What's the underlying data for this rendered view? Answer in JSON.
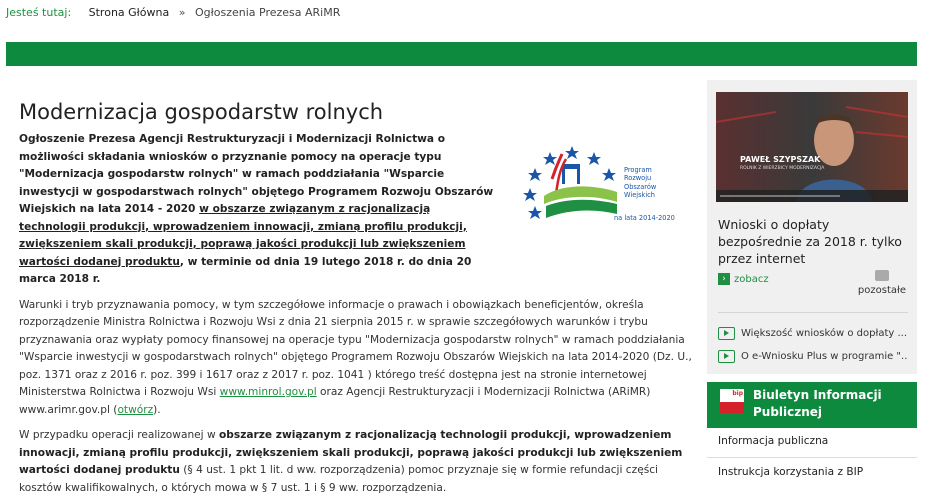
{
  "breadcrumb": {
    "label": "Jesteś tutaj:",
    "home": "Strona Główna",
    "separator": "»",
    "current": "Ogłoszenia Prezesa ARiMR"
  },
  "article": {
    "title": "Modernizacja gospodarstw rolnych",
    "lead_part1": "Ogłoszenie Prezesa Agencji Restrukturyzacji i Modernizacji Rolnictwa o możliwości składania wniosków o przyznanie pomocy na operacje typu \"Modernizacja gospodarstw rolnych\" w ramach poddziałania \"Wsparcie inwestycji w gospodarstwach rolnych\" objętego Programem Rozwoju Obszarów Wiejskich na lata 2014 - 2020 ",
    "lead_underlined": "w obszarze związanym z racjonalizacją technologii produkcji, wprowadzeniem innowacji, zmianą profilu produkcji, zwiększeniem skali produkcji, poprawą jakości produkcji lub zwiększeniem wartości dodanej produktu",
    "lead_part2": ", w terminie od dnia 19 lutego 2018 r. do dnia 20 marca 2018 r.",
    "p1_text": "Warunki i tryb przyznawania pomocy, w tym szczegółowe informacje o prawach i obowiązkach beneficjentów, określa rozporządzenie Ministra Rolnictwa i Rozwoju Wsi z dnia 21 sierpnia 2015 r. w sprawie szczegółowych warunków i trybu przyznawania oraz wypłaty pomocy finansowej na operacje typu \"Modernizacja gospodarstw rolnych\" w ramach poddziałania \"Wsparcie inwestycji w gospodarstwach rolnych\" objętego Programem Rozwoju Obszarów Wiejskich na lata 2014-2020 (Dz. U., poz. 1371 oraz z 2016 r. poz. 399 i 1617 oraz z 2017 r. poz. 1041 ) którego treść dostępna jest na stronie internetowej Ministerstwa Rolnictwa i Rozwoju Wsi ",
    "p1_link1": "www.minrol.gov.pl",
    "p1_mid": " oraz Agencji Restrukturyzacji i Modernizacji Rolnictwa (ARiMR) www.arimr.gov.pl (",
    "p1_link2": "otwórz",
    "p1_end": ").",
    "p2_start": "W przypadku operacji realizowanej w ",
    "p2_bold": "obszarze związanym z racjonalizacją technologii produkcji, wprowadzeniem innowacji, zmianą profilu produkcji, zwiększeniem skali produkcji, poprawą jakości produkcji lub zwiększeniem wartości dodanej produktu",
    "p2_end": " (§ 4 ust. 1 pkt 1 lit. d ww. rozporządzenia) pomoc przyznaje się w formie refundacji części kosztów kwalifikowalnych, o których mowa w § 7 ust. 1 i § 9 ww. rozporządzenia."
  },
  "logo": {
    "program_lines": [
      "Program",
      "Rozwoju",
      "Obszarów",
      "Wiejskich"
    ],
    "years": "na lata 2014-2020"
  },
  "video": {
    "caption_name": "PAWEŁ SZYPSZAK",
    "caption_role": "ROLNIK Z WIERZBICY MODERNIZACJA",
    "title": "Wnioski o dopłaty bezpośrednie za 2018 r. tylko przez internet",
    "watch": "zobacz",
    "others": "pozostałe",
    "list": [
      "Większość wniosków o dopłaty ...",
      "O e-Wniosku Plus w programie \"..."
    ]
  },
  "bip": {
    "flag_text": "bip",
    "title_line1": "Biuletyn Informacji",
    "title_line2": "Publicznej"
  },
  "side_links": [
    "Informacja publiczna",
    "Instrukcja korzystania z BIP"
  ],
  "colors": {
    "green": "#0d8a3e",
    "link_green": "#1f8f43",
    "bip_red": "#d5222a"
  }
}
